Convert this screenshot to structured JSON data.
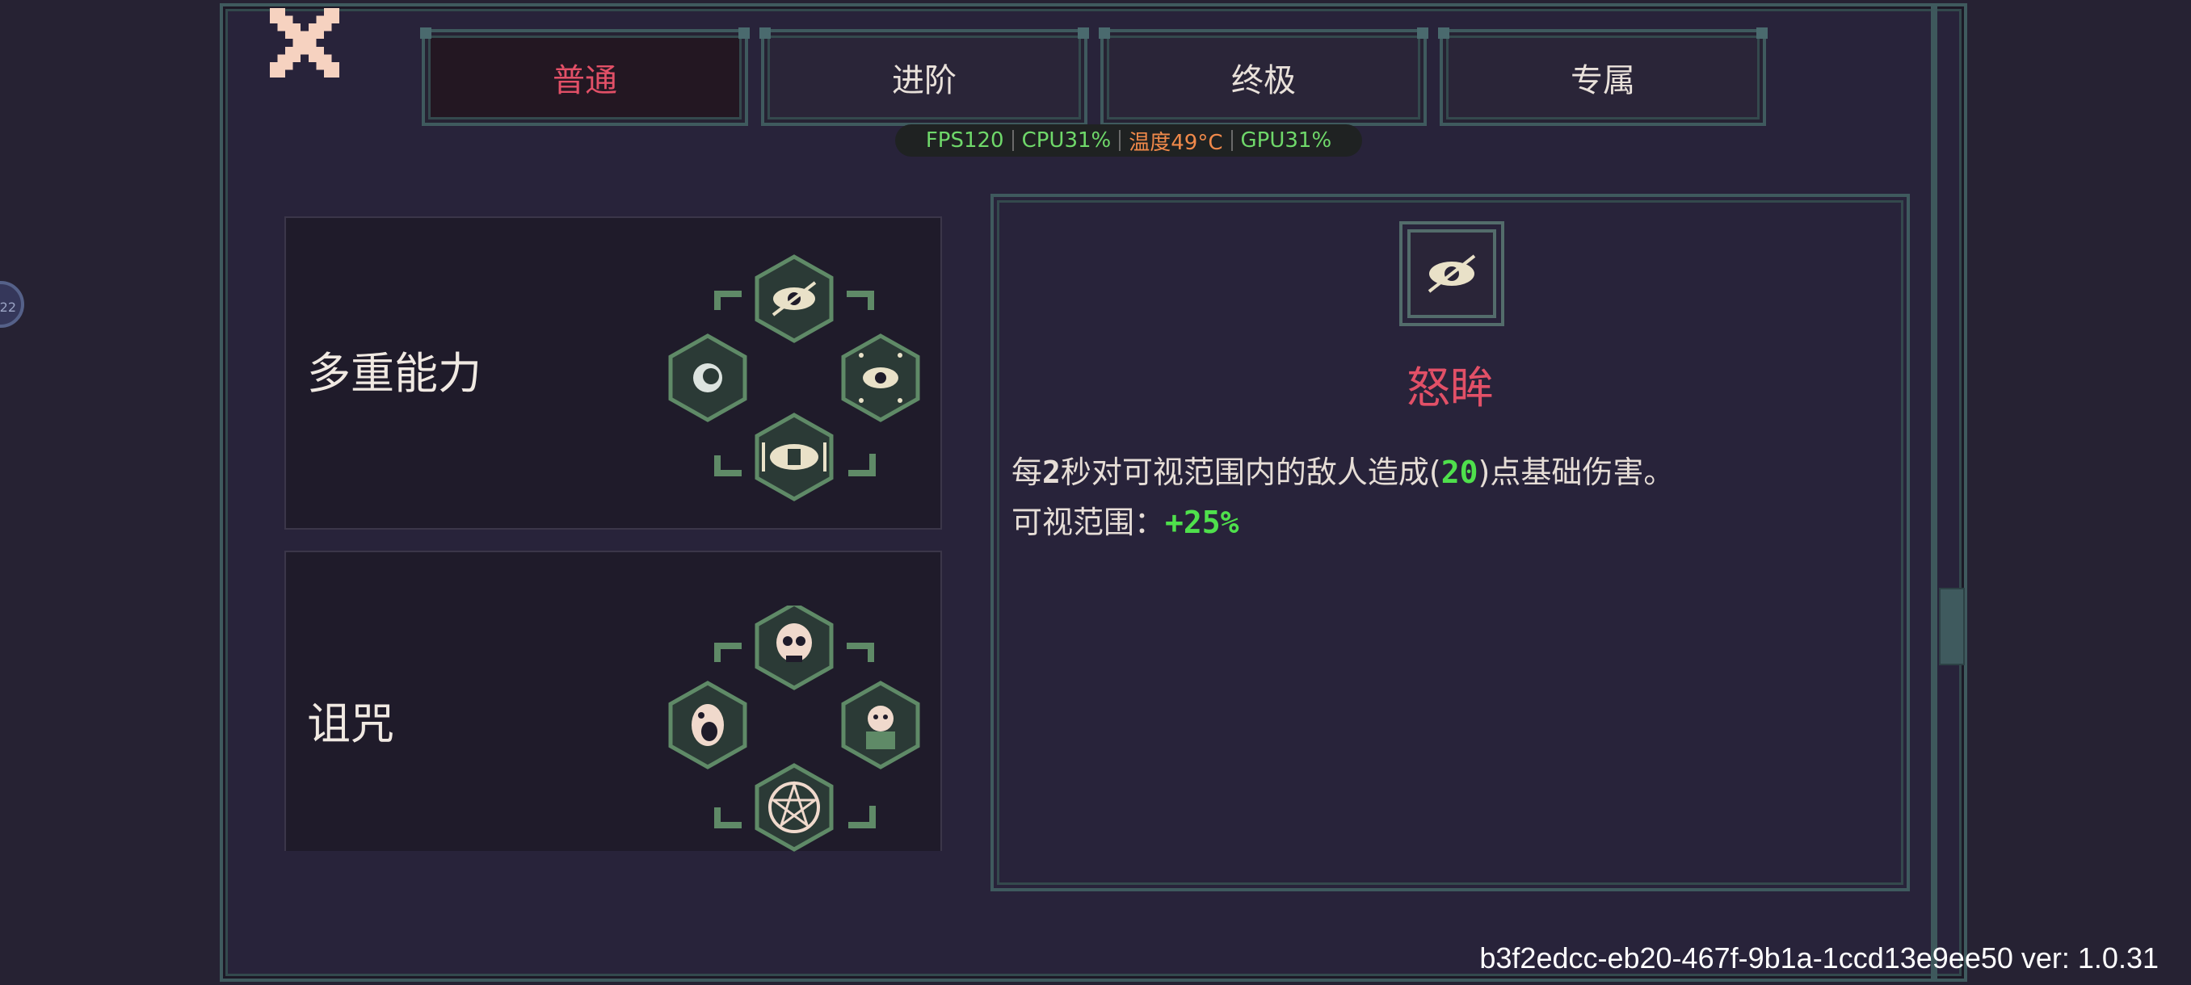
{
  "tabs": [
    {
      "label": "普通",
      "active": true
    },
    {
      "label": "进阶",
      "active": false
    },
    {
      "label": "终极",
      "active": false
    },
    {
      "label": "专属",
      "active": false
    }
  ],
  "perf": {
    "fps": "FPS120",
    "cpu": "CPU31%",
    "temp": "温度49°C",
    "gpu": "GPU31%"
  },
  "side_badge": "22",
  "cards": [
    {
      "title": "多重能力",
      "icons": [
        "eye-slash-icon",
        "eye-ring-icon",
        "sparkle-eye-icon",
        "barred-eye-icon"
      ]
    },
    {
      "title": "诅咒",
      "icons": [
        "skull-icon",
        "screaming-face-icon",
        "ghost-icon",
        "pentagram-icon"
      ]
    }
  ],
  "detail": {
    "icon": "eye-slash-icon",
    "name": "怒眸",
    "line1_pre": "每",
    "line1_num": "2",
    "line1_mid": "秒对可视范围内的敌人造成(",
    "line1_dmg": "20",
    "line1_post": ")点基础伤害。",
    "line2_pre": "可视范围：",
    "line2_val": "+25%"
  },
  "footer": "b3f2edcc-eb20-467f-9b1a-1ccd13e9ee50 ver: 1.0.31",
  "colors": {
    "accent_red": "#e25067",
    "highlight_green": "#4fe04c",
    "frame_teal": "#3f5a5e",
    "background": "#262233"
  }
}
